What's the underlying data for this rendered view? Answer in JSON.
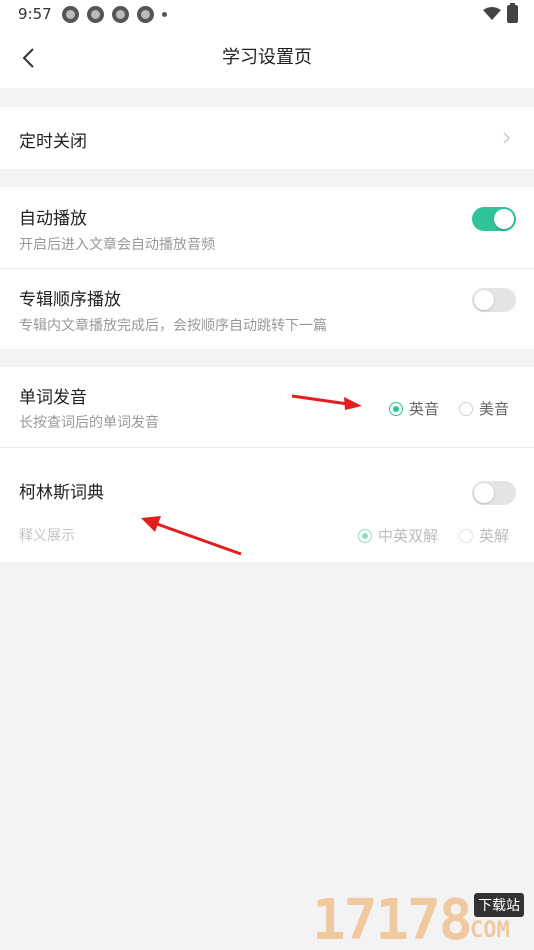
{
  "status_bar": {
    "time": "9:57"
  },
  "header": {
    "title": "学习设置页"
  },
  "rows": {
    "timer_close": {
      "title": "定时关闭"
    },
    "auto_play": {
      "title": "自动播放",
      "subtitle": "开启后进入文章会自动播放音频",
      "enabled": true
    },
    "album_order": {
      "title": "专辑顺序播放",
      "subtitle": "专辑内文章播放完成后，会按顺序自动跳转下一篇",
      "enabled": false
    },
    "pronunciation": {
      "title": "单词发音",
      "subtitle": "长按查词后的单词发音",
      "options": [
        "英音",
        "美音"
      ],
      "selected": "英音"
    },
    "collins": {
      "title": "柯林斯词典",
      "enabled": false,
      "sub_label": "释义展示",
      "options": [
        "中英双解",
        "英解"
      ],
      "selected": "中英双解"
    }
  },
  "watermark": {
    "digits": "17178",
    "badge": "下载站",
    "suffix": "COM"
  },
  "colors": {
    "accent": "#2ec39a",
    "arrow": "#e11d1d",
    "background": "#f3f3f3"
  }
}
